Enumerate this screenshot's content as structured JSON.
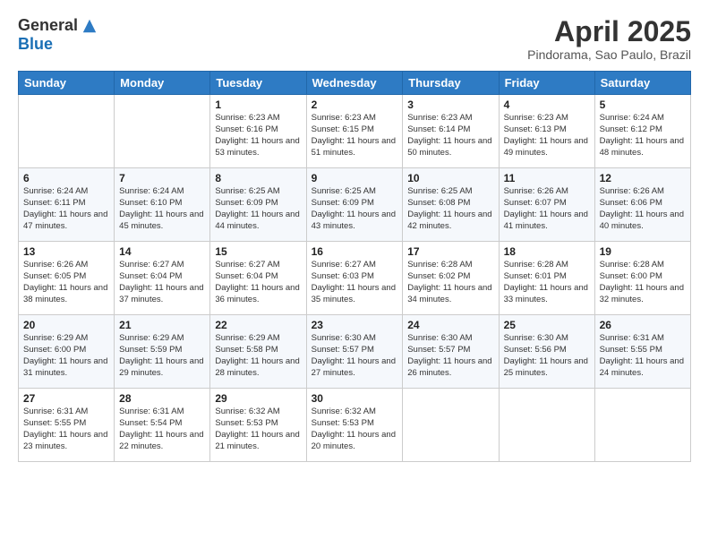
{
  "header": {
    "logo_general": "General",
    "logo_blue": "Blue",
    "title": "April 2025",
    "location": "Pindorama, Sao Paulo, Brazil"
  },
  "calendar": {
    "days_of_week": [
      "Sunday",
      "Monday",
      "Tuesday",
      "Wednesday",
      "Thursday",
      "Friday",
      "Saturday"
    ],
    "weeks": [
      [
        {
          "day": "",
          "info": ""
        },
        {
          "day": "",
          "info": ""
        },
        {
          "day": "1",
          "info": "Sunrise: 6:23 AM\nSunset: 6:16 PM\nDaylight: 11 hours and 53 minutes."
        },
        {
          "day": "2",
          "info": "Sunrise: 6:23 AM\nSunset: 6:15 PM\nDaylight: 11 hours and 51 minutes."
        },
        {
          "day": "3",
          "info": "Sunrise: 6:23 AM\nSunset: 6:14 PM\nDaylight: 11 hours and 50 minutes."
        },
        {
          "day": "4",
          "info": "Sunrise: 6:23 AM\nSunset: 6:13 PM\nDaylight: 11 hours and 49 minutes."
        },
        {
          "day": "5",
          "info": "Sunrise: 6:24 AM\nSunset: 6:12 PM\nDaylight: 11 hours and 48 minutes."
        }
      ],
      [
        {
          "day": "6",
          "info": "Sunrise: 6:24 AM\nSunset: 6:11 PM\nDaylight: 11 hours and 47 minutes."
        },
        {
          "day": "7",
          "info": "Sunrise: 6:24 AM\nSunset: 6:10 PM\nDaylight: 11 hours and 45 minutes."
        },
        {
          "day": "8",
          "info": "Sunrise: 6:25 AM\nSunset: 6:09 PM\nDaylight: 11 hours and 44 minutes."
        },
        {
          "day": "9",
          "info": "Sunrise: 6:25 AM\nSunset: 6:09 PM\nDaylight: 11 hours and 43 minutes."
        },
        {
          "day": "10",
          "info": "Sunrise: 6:25 AM\nSunset: 6:08 PM\nDaylight: 11 hours and 42 minutes."
        },
        {
          "day": "11",
          "info": "Sunrise: 6:26 AM\nSunset: 6:07 PM\nDaylight: 11 hours and 41 minutes."
        },
        {
          "day": "12",
          "info": "Sunrise: 6:26 AM\nSunset: 6:06 PM\nDaylight: 11 hours and 40 minutes."
        }
      ],
      [
        {
          "day": "13",
          "info": "Sunrise: 6:26 AM\nSunset: 6:05 PM\nDaylight: 11 hours and 38 minutes."
        },
        {
          "day": "14",
          "info": "Sunrise: 6:27 AM\nSunset: 6:04 PM\nDaylight: 11 hours and 37 minutes."
        },
        {
          "day": "15",
          "info": "Sunrise: 6:27 AM\nSunset: 6:04 PM\nDaylight: 11 hours and 36 minutes."
        },
        {
          "day": "16",
          "info": "Sunrise: 6:27 AM\nSunset: 6:03 PM\nDaylight: 11 hours and 35 minutes."
        },
        {
          "day": "17",
          "info": "Sunrise: 6:28 AM\nSunset: 6:02 PM\nDaylight: 11 hours and 34 minutes."
        },
        {
          "day": "18",
          "info": "Sunrise: 6:28 AM\nSunset: 6:01 PM\nDaylight: 11 hours and 33 minutes."
        },
        {
          "day": "19",
          "info": "Sunrise: 6:28 AM\nSunset: 6:00 PM\nDaylight: 11 hours and 32 minutes."
        }
      ],
      [
        {
          "day": "20",
          "info": "Sunrise: 6:29 AM\nSunset: 6:00 PM\nDaylight: 11 hours and 31 minutes."
        },
        {
          "day": "21",
          "info": "Sunrise: 6:29 AM\nSunset: 5:59 PM\nDaylight: 11 hours and 29 minutes."
        },
        {
          "day": "22",
          "info": "Sunrise: 6:29 AM\nSunset: 5:58 PM\nDaylight: 11 hours and 28 minutes."
        },
        {
          "day": "23",
          "info": "Sunrise: 6:30 AM\nSunset: 5:57 PM\nDaylight: 11 hours and 27 minutes."
        },
        {
          "day": "24",
          "info": "Sunrise: 6:30 AM\nSunset: 5:57 PM\nDaylight: 11 hours and 26 minutes."
        },
        {
          "day": "25",
          "info": "Sunrise: 6:30 AM\nSunset: 5:56 PM\nDaylight: 11 hours and 25 minutes."
        },
        {
          "day": "26",
          "info": "Sunrise: 6:31 AM\nSunset: 5:55 PM\nDaylight: 11 hours and 24 minutes."
        }
      ],
      [
        {
          "day": "27",
          "info": "Sunrise: 6:31 AM\nSunset: 5:55 PM\nDaylight: 11 hours and 23 minutes."
        },
        {
          "day": "28",
          "info": "Sunrise: 6:31 AM\nSunset: 5:54 PM\nDaylight: 11 hours and 22 minutes."
        },
        {
          "day": "29",
          "info": "Sunrise: 6:32 AM\nSunset: 5:53 PM\nDaylight: 11 hours and 21 minutes."
        },
        {
          "day": "30",
          "info": "Sunrise: 6:32 AM\nSunset: 5:53 PM\nDaylight: 11 hours and 20 minutes."
        },
        {
          "day": "",
          "info": ""
        },
        {
          "day": "",
          "info": ""
        },
        {
          "day": "",
          "info": ""
        }
      ]
    ]
  }
}
